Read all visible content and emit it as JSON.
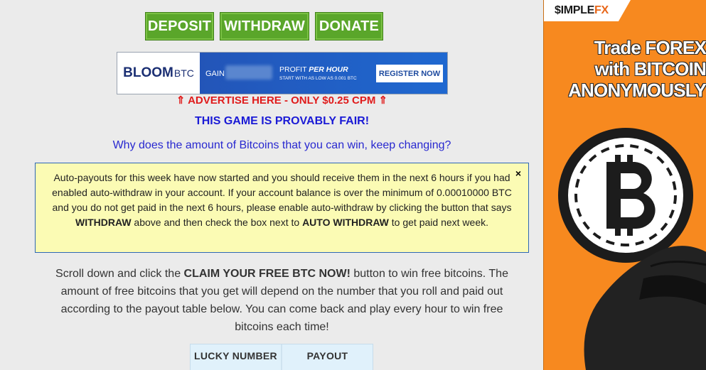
{
  "nav": {
    "deposit": "DEPOSIT",
    "withdraw": "WITHDRAW",
    "donate": "DONATE"
  },
  "banner": {
    "logo_main": "BLOOM",
    "logo_sub": "BTC",
    "gain": "GAIN",
    "profit_prefix": "PROFIT",
    "profit_emph": "PER HOUR",
    "start_text": "START WITH AS LOW AS 0.001 BTC",
    "register": "REGISTER NOW"
  },
  "advertise": "⇑ ADVERTISE HERE - ONLY $0.25 CPM ⇑",
  "provably_fair": "THIS GAME IS PROVABLY FAIR!",
  "why_link": "Why does the amount of Bitcoins that you can win, keep changing?",
  "notice": {
    "close": "×",
    "text1": "Auto-payouts for this week have now started and you should receive them in the next 6 hours if you had enabled auto-withdraw in your account. If your account balance is over the minimum of 0.00010000 BTC and you do not get paid in the next 6 hours, please enable auto-withdraw by clicking the button that says ",
    "bold1": "WITHDRAW",
    "text2": " above and then check the box next to ",
    "bold2": "AUTO WITHDRAW",
    "text3": " to get paid next week."
  },
  "instructions": {
    "pre": "Scroll down and click the ",
    "bold": "CLAIM YOUR FREE BTC NOW!",
    "post": " button to win free bitcoins. The amount of free bitcoins that you get will depend on the number that you roll and paid out according to the payout table below. You can come back and play every hour to win free bitcoins each time!"
  },
  "payout_table": {
    "headers": [
      "LUCKY NUMBER",
      "PAYOUT"
    ]
  },
  "side_ad": {
    "logo_s": "$IMPLE",
    "logo_fx": "FX",
    "headline_line1": "Trade FOREX",
    "headline_line2": "with BITCOIN",
    "headline_line3": "ANONYMOUSLY"
  }
}
